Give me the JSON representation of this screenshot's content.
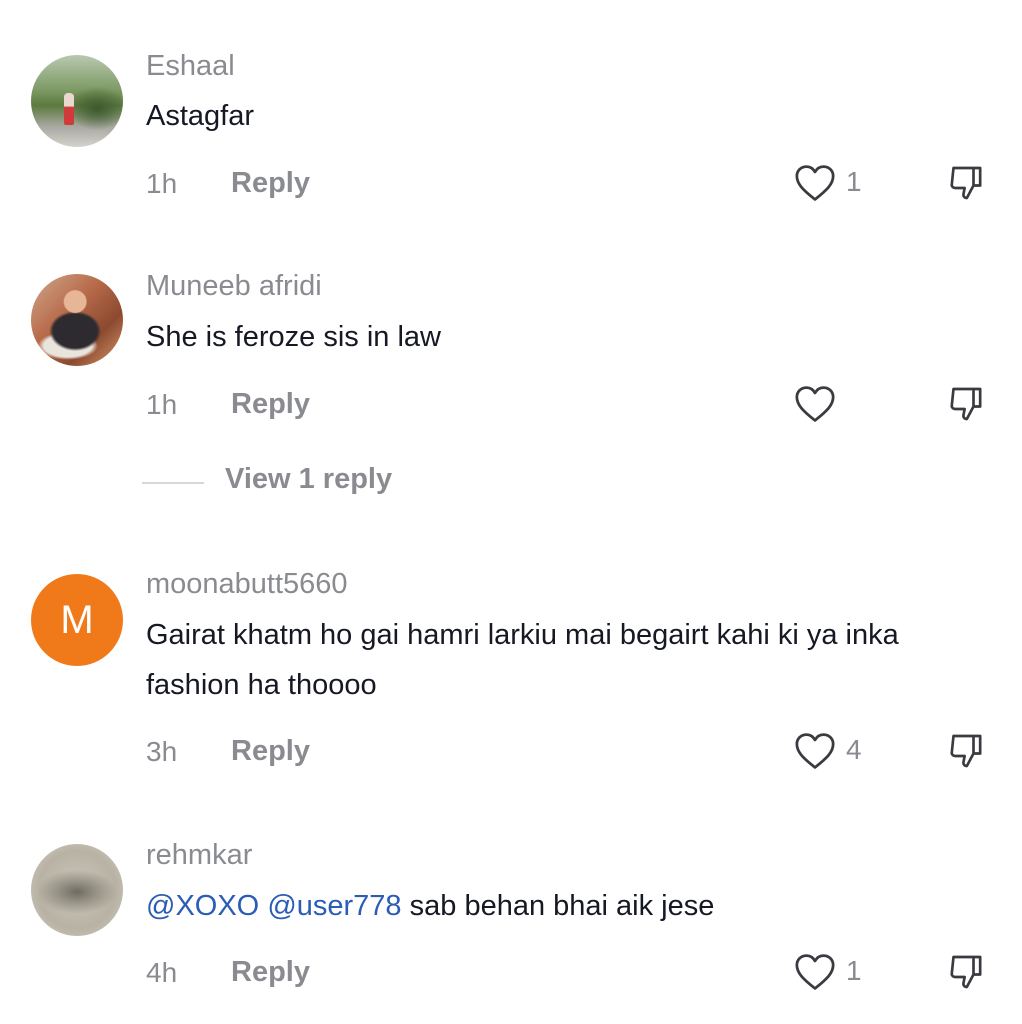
{
  "comments": [
    {
      "username": "Eshaal",
      "text": "Astagfar",
      "time": "1h",
      "reply_label": "Reply",
      "like_count": "1",
      "avatar": "photo"
    },
    {
      "username": "Muneeb afridi",
      "text": "She is feroze sis in law",
      "time": "1h",
      "reply_label": "Reply",
      "like_count": "",
      "avatar": "photo",
      "view_replies_label": "View 1 reply"
    },
    {
      "username": "moonabutt5660",
      "text": "Gairat khatm ho gai hamri larkiu mai begairt kahi ki ya inka fashion ha thoooo",
      "time": "3h",
      "reply_label": "Reply",
      "like_count": "4",
      "avatar_letter": "M",
      "avatar_color": "#f07a1a"
    },
    {
      "username": "rehmkar",
      "mentions": [
        "@XOXO",
        "@user778"
      ],
      "text": "sab behan bhai aik jese",
      "time": "4h",
      "reply_label": "Reply",
      "like_count": "1",
      "avatar": "photo"
    }
  ],
  "icons": {
    "like": "heart-outline-icon",
    "dislike": "thumbs-down-outline-icon"
  },
  "colors": {
    "username": "#8a8b91",
    "text": "#161823",
    "mention": "#2b5db4",
    "avatar_letter_bg": "#f07a1a"
  }
}
